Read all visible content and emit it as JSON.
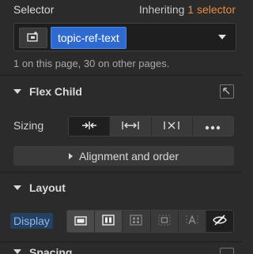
{
  "selector": {
    "title": "Selector",
    "inheriting_prefix": "Inheriting",
    "inheriting_count": "1 selector",
    "tag_label": "topic-ref-text",
    "usage_text": "1 on this page, 30 on other pages."
  },
  "flex_child": {
    "title": "Flex Child",
    "sizing_label": "Sizing",
    "sizing_options": [
      "shrink-icon",
      "grow-icon",
      "none-icon",
      "more-icon"
    ],
    "alignment_label": "Alignment and order"
  },
  "layout": {
    "title": "Layout",
    "display_label": "Display",
    "display_options": [
      "block",
      "flex",
      "grid",
      "inline-block",
      "inline",
      "none"
    ]
  },
  "spacing": {
    "title": "Spacing"
  },
  "colors": {
    "accent_orange": "#f08a3c",
    "tag_blue": "#2f6ad0",
    "panel_bg": "#2b2b2b"
  }
}
